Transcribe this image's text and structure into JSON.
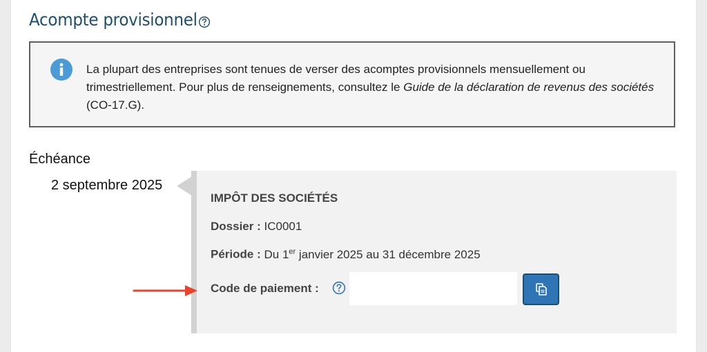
{
  "header": {
    "title": "Acompte provisionnel"
  },
  "info": {
    "text_before": "La plupart des entreprises sont tenues de verser des acomptes provisionnels mensuellement ou trimestriellement. Pour plus de renseignements, consultez le ",
    "guide_title": "Guide de la déclaration de revenus des sociétés",
    "text_after": " (CO-17.G)."
  },
  "deadline": {
    "label": "Échéance",
    "date": "2 septembre 2025"
  },
  "card": {
    "title": "IMPÔT DES SOCIÉTÉS",
    "dossier_label": "Dossier :",
    "dossier_value": "IC0001",
    "periode_label": "Période :",
    "periode_prefix": "Du 1",
    "periode_sup": "er",
    "periode_suffix": " janvier 2025 au 31 décembre 2025",
    "code_label": "Code de paiement :",
    "code_value": ""
  },
  "icons": {
    "help": "question-circle-icon",
    "info": "info-circle-icon",
    "copy": "copy-icon",
    "arrow": "red-arrow-annotation"
  },
  "colors": {
    "title": "#1d4f6e",
    "info_icon": "#4a9bd6",
    "copy_button": "#2f74b5",
    "arrow": "#e8432b"
  }
}
